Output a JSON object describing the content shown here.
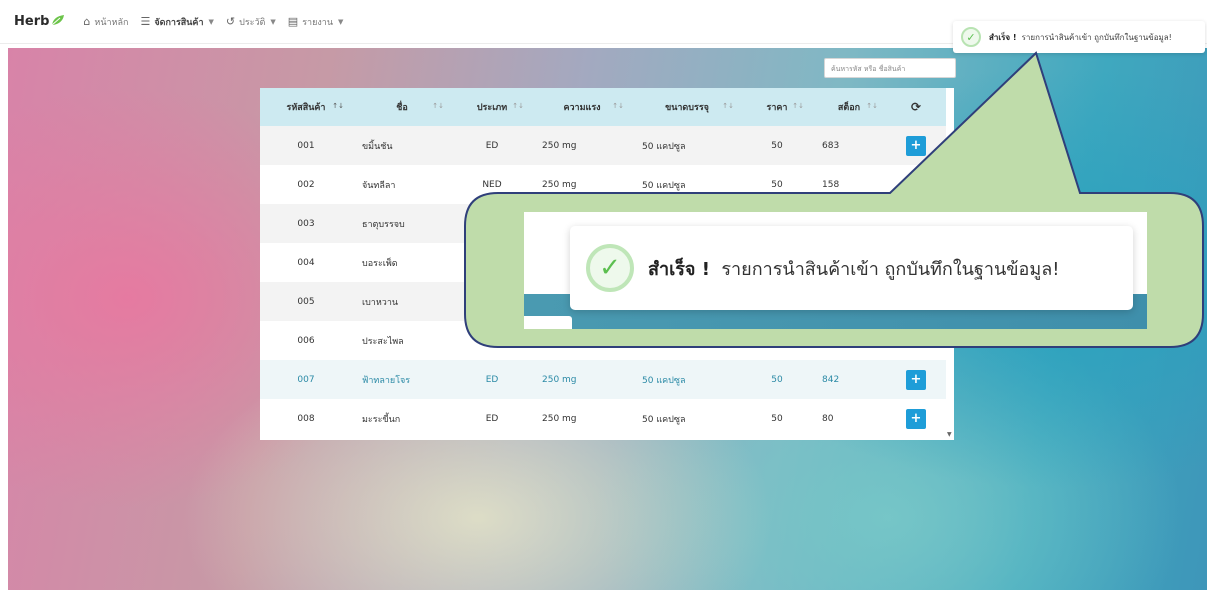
{
  "nav": {
    "brand": "Herb",
    "brand_icon": "leaf-icon",
    "items": [
      {
        "label": "หน้าหลัก",
        "icon": "home-icon",
        "dropdown": false
      },
      {
        "label": "จัดการสินค้า",
        "icon": "list-icon",
        "dropdown": true
      },
      {
        "label": "ประวัติ",
        "icon": "history-icon",
        "dropdown": true
      },
      {
        "label": "รายงาน",
        "icon": "report-icon",
        "dropdown": true
      }
    ]
  },
  "search": {
    "placeholder": "ค้นหารหัส หรือ ชื่อสินค้า"
  },
  "table": {
    "columns": [
      "รหัสสินค้า",
      "ชื่อ",
      "ประเภท",
      "ความแรง",
      "ขนาดบรรจุ",
      "ราคา",
      "สต็อก"
    ],
    "refresh_icon": "refresh-icon",
    "rows": [
      {
        "code": "001",
        "name": "ขมิ้นชัน",
        "type": "ED",
        "strength": "250 mg",
        "pack": "50 แคปซูล",
        "price": "50",
        "stock": "683"
      },
      {
        "code": "002",
        "name": "จันทลีลา",
        "type": "NED",
        "strength": "250 mg",
        "pack": "50 แคปซูล",
        "price": "50",
        "stock": "158"
      },
      {
        "code": "003",
        "name": "ธาตุบรรจบ",
        "type": "",
        "strength": "",
        "pack": "",
        "price": "",
        "stock": ""
      },
      {
        "code": "004",
        "name": "บอระเพ็ด",
        "type": "",
        "strength": "",
        "pack": "",
        "price": "",
        "stock": ""
      },
      {
        "code": "005",
        "name": "เบาหวาน",
        "type": "",
        "strength": "",
        "pack": "",
        "price": "",
        "stock": ""
      },
      {
        "code": "006",
        "name": "ประสะไพล",
        "type": "",
        "strength": "",
        "pack": "",
        "price": "",
        "stock": ""
      },
      {
        "code": "007",
        "name": "ฟ้าทลายโจร",
        "type": "ED",
        "strength": "250 mg",
        "pack": "50 แคปซูล",
        "price": "50",
        "stock": "842"
      },
      {
        "code": "008",
        "name": "มะระขี้นก",
        "type": "ED",
        "strength": "250 mg",
        "pack": "50 แคปซูล",
        "price": "50",
        "stock": "80"
      }
    ],
    "add_label": "+"
  },
  "toast": {
    "title": "สำเร็จ !",
    "message": "รายการนำสินค้าเข้า ถูกบันทึกในฐานข้อมูล!",
    "icon": "check-circle-icon"
  },
  "colors": {
    "accent": "#1e9dd8",
    "success": "#5cbf50",
    "header_bg": "#cdeaf1",
    "callout": "#bfdcaa",
    "callout_border": "#2f3f7a"
  }
}
